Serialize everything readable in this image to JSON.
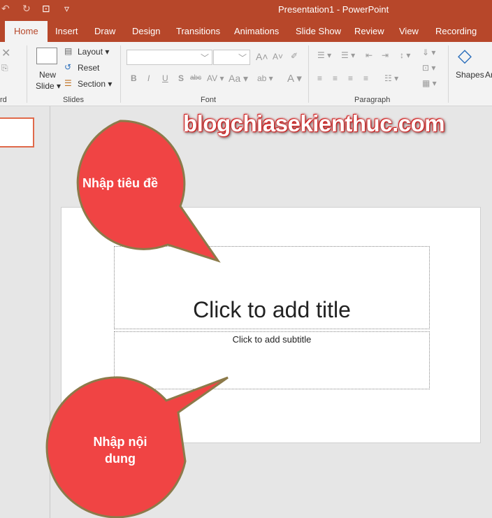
{
  "window": {
    "title": "Presentation1  -  PowerPoint"
  },
  "quick_access": {
    "undo": "↶",
    "redo": "↻",
    "present": "⊡",
    "customize": "▿"
  },
  "tabs": [
    {
      "label": "Home",
      "active": true
    },
    {
      "label": "Insert"
    },
    {
      "label": "Draw"
    },
    {
      "label": "Design"
    },
    {
      "label": "Transitions"
    },
    {
      "label": "Animations"
    },
    {
      "label": "Slide Show"
    },
    {
      "label": "Review"
    },
    {
      "label": "View"
    },
    {
      "label": "Recording"
    }
  ],
  "ribbon": {
    "clipboard_label": "rd",
    "slides": {
      "new_slide": "New",
      "new_slide2": "Slide ▾",
      "layout": "Layout ▾",
      "reset": "Reset",
      "section": "Section ▾",
      "label": "Slides"
    },
    "font": {
      "label": "Font",
      "bold": "B",
      "italic": "I",
      "underline": "U",
      "shadow": "S",
      "strike": "abc",
      "spacing": "AV ▾",
      "case": "Aa ▾",
      "grow": "A˄",
      "shrink": "A˅",
      "highlight": "ab ▾",
      "color": "A ▾"
    },
    "paragraph": {
      "label": "Paragraph"
    },
    "drawing": {
      "shapes": "Shapes",
      "arrange": "Ar"
    }
  },
  "slide": {
    "title_placeholder": "Click to add title",
    "subtitle_placeholder": "Click to add subtitle"
  },
  "callouts": {
    "title": "Nhập tiêu đề",
    "content_line1": "Nhập nội",
    "content_line2": "dung",
    "color": "#f04444"
  },
  "watermark": "blogchiasekienthuc.com",
  "colors": {
    "accent": "#b7472a"
  }
}
